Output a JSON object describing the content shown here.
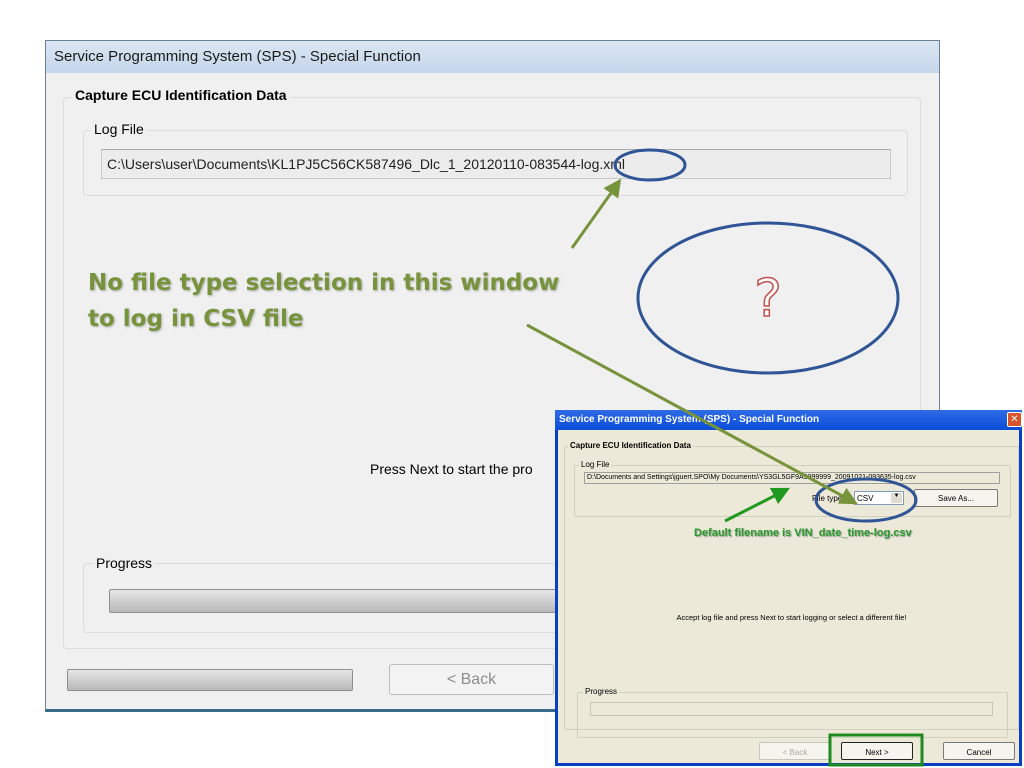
{
  "main_window": {
    "title": "Service Programming System (SPS) - Special Function",
    "section": "Capture ECU Identification Data",
    "log_file_label": "Log File",
    "log_file_path": "C:\\Users\\user\\Documents\\KL1PJ5C56CK587496_Dlc_1_20120110-083544-log.xml",
    "instruction": "Press Next to start the pro",
    "progress_label": "Progress",
    "back_button": "< Back"
  },
  "overlay_window": {
    "title": "Service Programming System (SPS) - Special Function",
    "section": "Capture ECU Identification Data",
    "log_file_label": "Log File",
    "log_file_path": "D:\\Documents and Settings\\jguert.SPO\\My Documents\\YS3GL5GF9A9999999_20091021-093635-log.csv",
    "file_type_label": "File type:",
    "file_type_value": "CSV",
    "save_as_button": "Save As...",
    "instruction": "Accept log file and press Next to start logging or select a different file!",
    "progress_label": "Progress",
    "back_button": "< Back",
    "next_button": "Next >",
    "cancel_button": "Cancel"
  },
  "annotations": {
    "note_line1": "No file type selection in this window",
    "note_line2": "to log in CSV file",
    "question_mark": "?",
    "default_filename_note": "Default filename is VIN_date_time-log.csv"
  },
  "colors": {
    "annotation_green": "#77933c",
    "ellipse_blue": "#2f5597",
    "highlight_green": "#1f8a1f"
  }
}
